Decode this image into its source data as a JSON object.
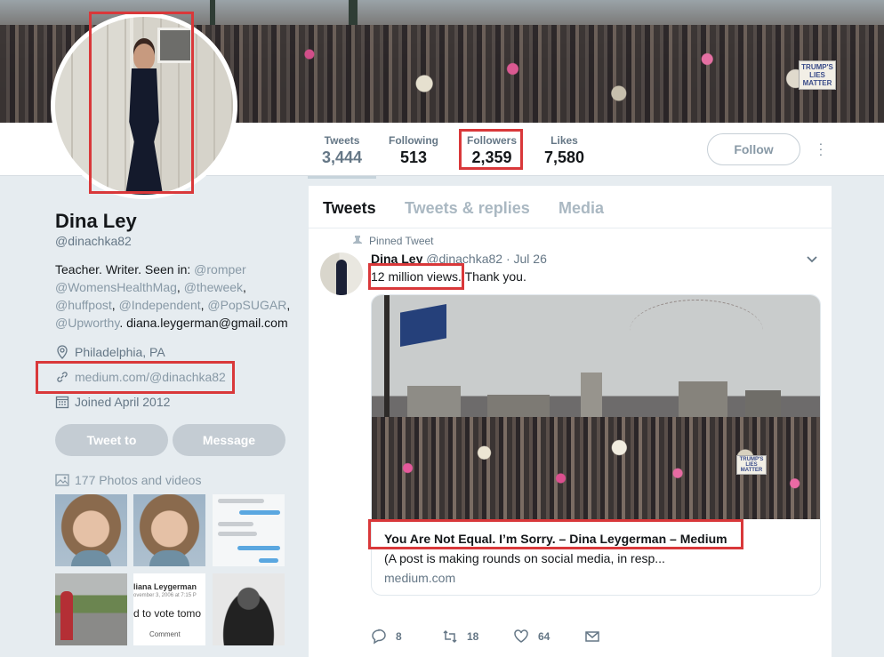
{
  "profile": {
    "name": "Dina Ley",
    "handle": "@dinachka82",
    "bio_lead": "Teacher. Writer. Seen in: ",
    "bio_mentions": [
      "@romper",
      "@WomensHealthMag",
      "@theweek",
      "@huffpost",
      "@Independent",
      "@PopSUGAR",
      "@Upworthy"
    ],
    "email": "diana.leygerman@gmail.com",
    "location": "Philadelphia, PA",
    "website": "medium.com/@dinachka82",
    "joined": "Joined April 2012",
    "tweet_to_label": "Tweet to",
    "message_label": "Message",
    "photos_label": "177 Photos and videos"
  },
  "stats": [
    {
      "label": "Tweets",
      "value": "3,444"
    },
    {
      "label": "Following",
      "value": "513"
    },
    {
      "label": "Followers",
      "value": "2,359"
    },
    {
      "label": "Likes",
      "value": "7,580"
    }
  ],
  "follow_label": "Follow",
  "banner_signs": [
    "TRUMP'S",
    "LIES",
    "MATTER"
  ],
  "thumb_texts": {
    "article_name": "liana Leygerman",
    "article_date": "ovember 3, 2006 at 7:15 P",
    "article_body": "d to vote tomo",
    "article_comment": "Comment"
  },
  "tabs": [
    "Tweets",
    "Tweets & replies",
    "Media"
  ],
  "tweet": {
    "pinned_label": "Pinned Tweet",
    "author": "Dina Ley",
    "handle": "@dinachka82",
    "date": "· Jul 26",
    "text_highlight": "12 million views",
    "text_rest": ". Thank you.",
    "card_title": "You Are Not Equal. I’m Sorry. – Dina Leygerman – Medium",
    "card_desc": "(A post is making rounds on social media, in resp...",
    "card_domain": "medium.com",
    "card_image_signs": [
      "TRUMP'S",
      "LIES",
      "MATTER"
    ],
    "replies": "8",
    "retweets": "18",
    "likes": "64"
  },
  "colors": {
    "annotation_red": "#d9383a",
    "link_grey": "#8899a6",
    "button_grey": "#c4ccd3"
  }
}
